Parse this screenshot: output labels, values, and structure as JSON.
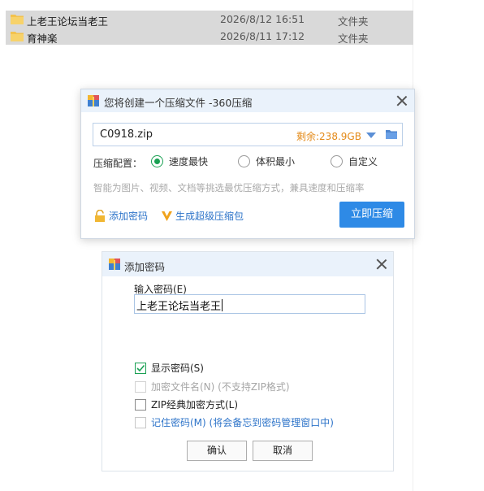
{
  "explorer": {
    "files": [
      {
        "name": "上老王论坛当老王",
        "date": "2026/8/12 16:51",
        "type": "文件夹"
      },
      {
        "name": "育神楽",
        "date": "2026/8/11 17:12",
        "type": "文件夹"
      }
    ]
  },
  "compress_dialog": {
    "title": "您将创建一个压缩文件 -360压缩",
    "filename": "C0918.zip",
    "free_space": "剩余:238.9GB",
    "config_label": "压缩配置：",
    "options": [
      {
        "label": "速度最快",
        "checked": true
      },
      {
        "label": "体积最小",
        "checked": false
      },
      {
        "label": "自定义",
        "checked": false
      }
    ],
    "hint": "智能为图片、视频、文档等挑选最优压缩方式，兼具速度和压缩率",
    "add_password_link": "添加密码",
    "super_pack_link": "生成超级压缩包",
    "compress_button": "立即压缩"
  },
  "password_dialog": {
    "title": "添加密码",
    "input_label": "输入密码(E)",
    "password_value": "上老王论坛当老王",
    "options": {
      "show_password": {
        "label": "显示密码(S)",
        "checked": true
      },
      "encrypt_filenames": {
        "label": "加密文件名(N)",
        "note": "(不支持ZIP格式)",
        "checked": false,
        "disabled": true
      },
      "zip_classic": {
        "label": "ZIP经典加密方式(L)",
        "checked": false
      },
      "remember_password": {
        "label": "记住密码(M)",
        "note": "(将会备忘到密码管理窗口中)",
        "checked": false
      }
    },
    "ok_button": "确认",
    "cancel_button": "取消"
  },
  "colors": {
    "accent_blue": "#2e8ae6",
    "link_blue": "#2e74c9",
    "check_green": "#1aa053",
    "free_space_orange": "#e48a18",
    "folder_yellow": "#f3c24d"
  }
}
